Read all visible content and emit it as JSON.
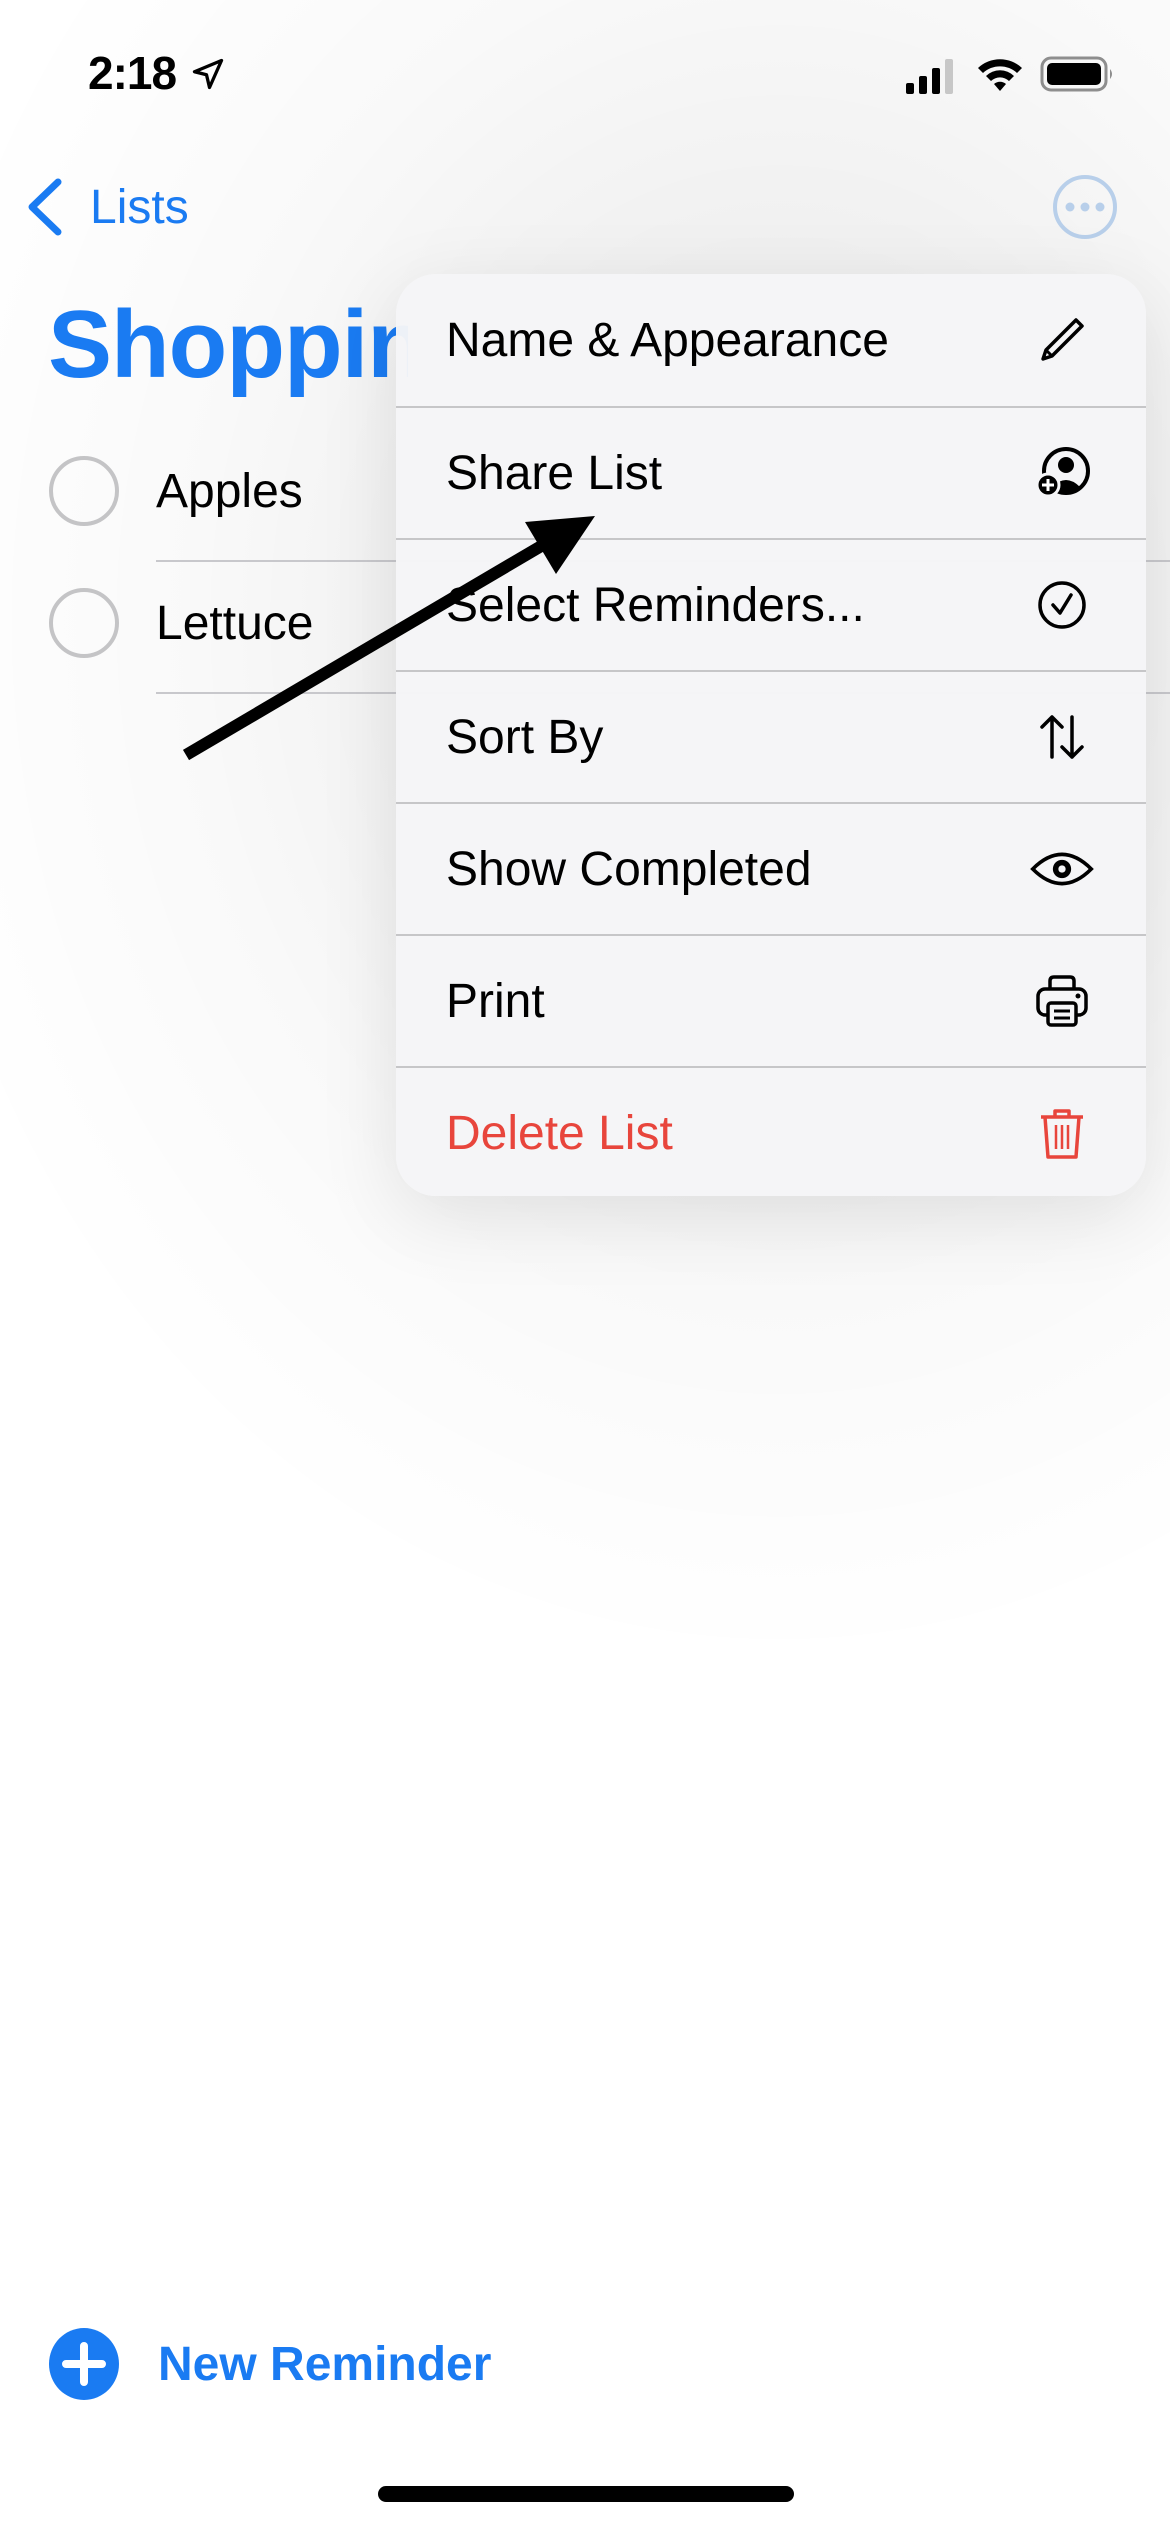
{
  "status_bar": {
    "time": "2:18",
    "location_icon": "location-arrow-icon",
    "signal_bars_filled": 3,
    "signal_bars_total": 4,
    "wifi_icon": "wifi-icon",
    "battery_level_percent": 95
  },
  "nav": {
    "back_label": "Lists",
    "back_icon": "chevron-left-icon",
    "more_icon": "ellipsis-circle-icon"
  },
  "list": {
    "title": "Shopping",
    "items": [
      {
        "label": "Apples",
        "completed": false
      },
      {
        "label": "Lettuce",
        "completed": false
      }
    ]
  },
  "menu": {
    "items": [
      {
        "label": "Name & Appearance",
        "icon": "pencil-icon",
        "destructive": false
      },
      {
        "label": "Share List",
        "icon": "person-add-icon",
        "destructive": false
      },
      {
        "label": "Select Reminders...",
        "icon": "checkmark-circle-icon",
        "destructive": false
      },
      {
        "label": "Sort By",
        "icon": "sort-arrows-icon",
        "destructive": false
      },
      {
        "label": "Show Completed",
        "icon": "eye-icon",
        "destructive": false
      },
      {
        "label": "Print",
        "icon": "printer-icon",
        "destructive": false
      },
      {
        "label": "Delete List",
        "icon": "trash-icon",
        "destructive": true
      }
    ]
  },
  "annotation": {
    "type": "arrow",
    "points_to": "Share List"
  },
  "footer": {
    "new_reminder_label": "New Reminder",
    "new_reminder_icon": "plus-circle-icon"
  },
  "colors": {
    "accent": "#1a7bf2",
    "destructive": "#e8453c",
    "more_button": "#b8cfea"
  }
}
